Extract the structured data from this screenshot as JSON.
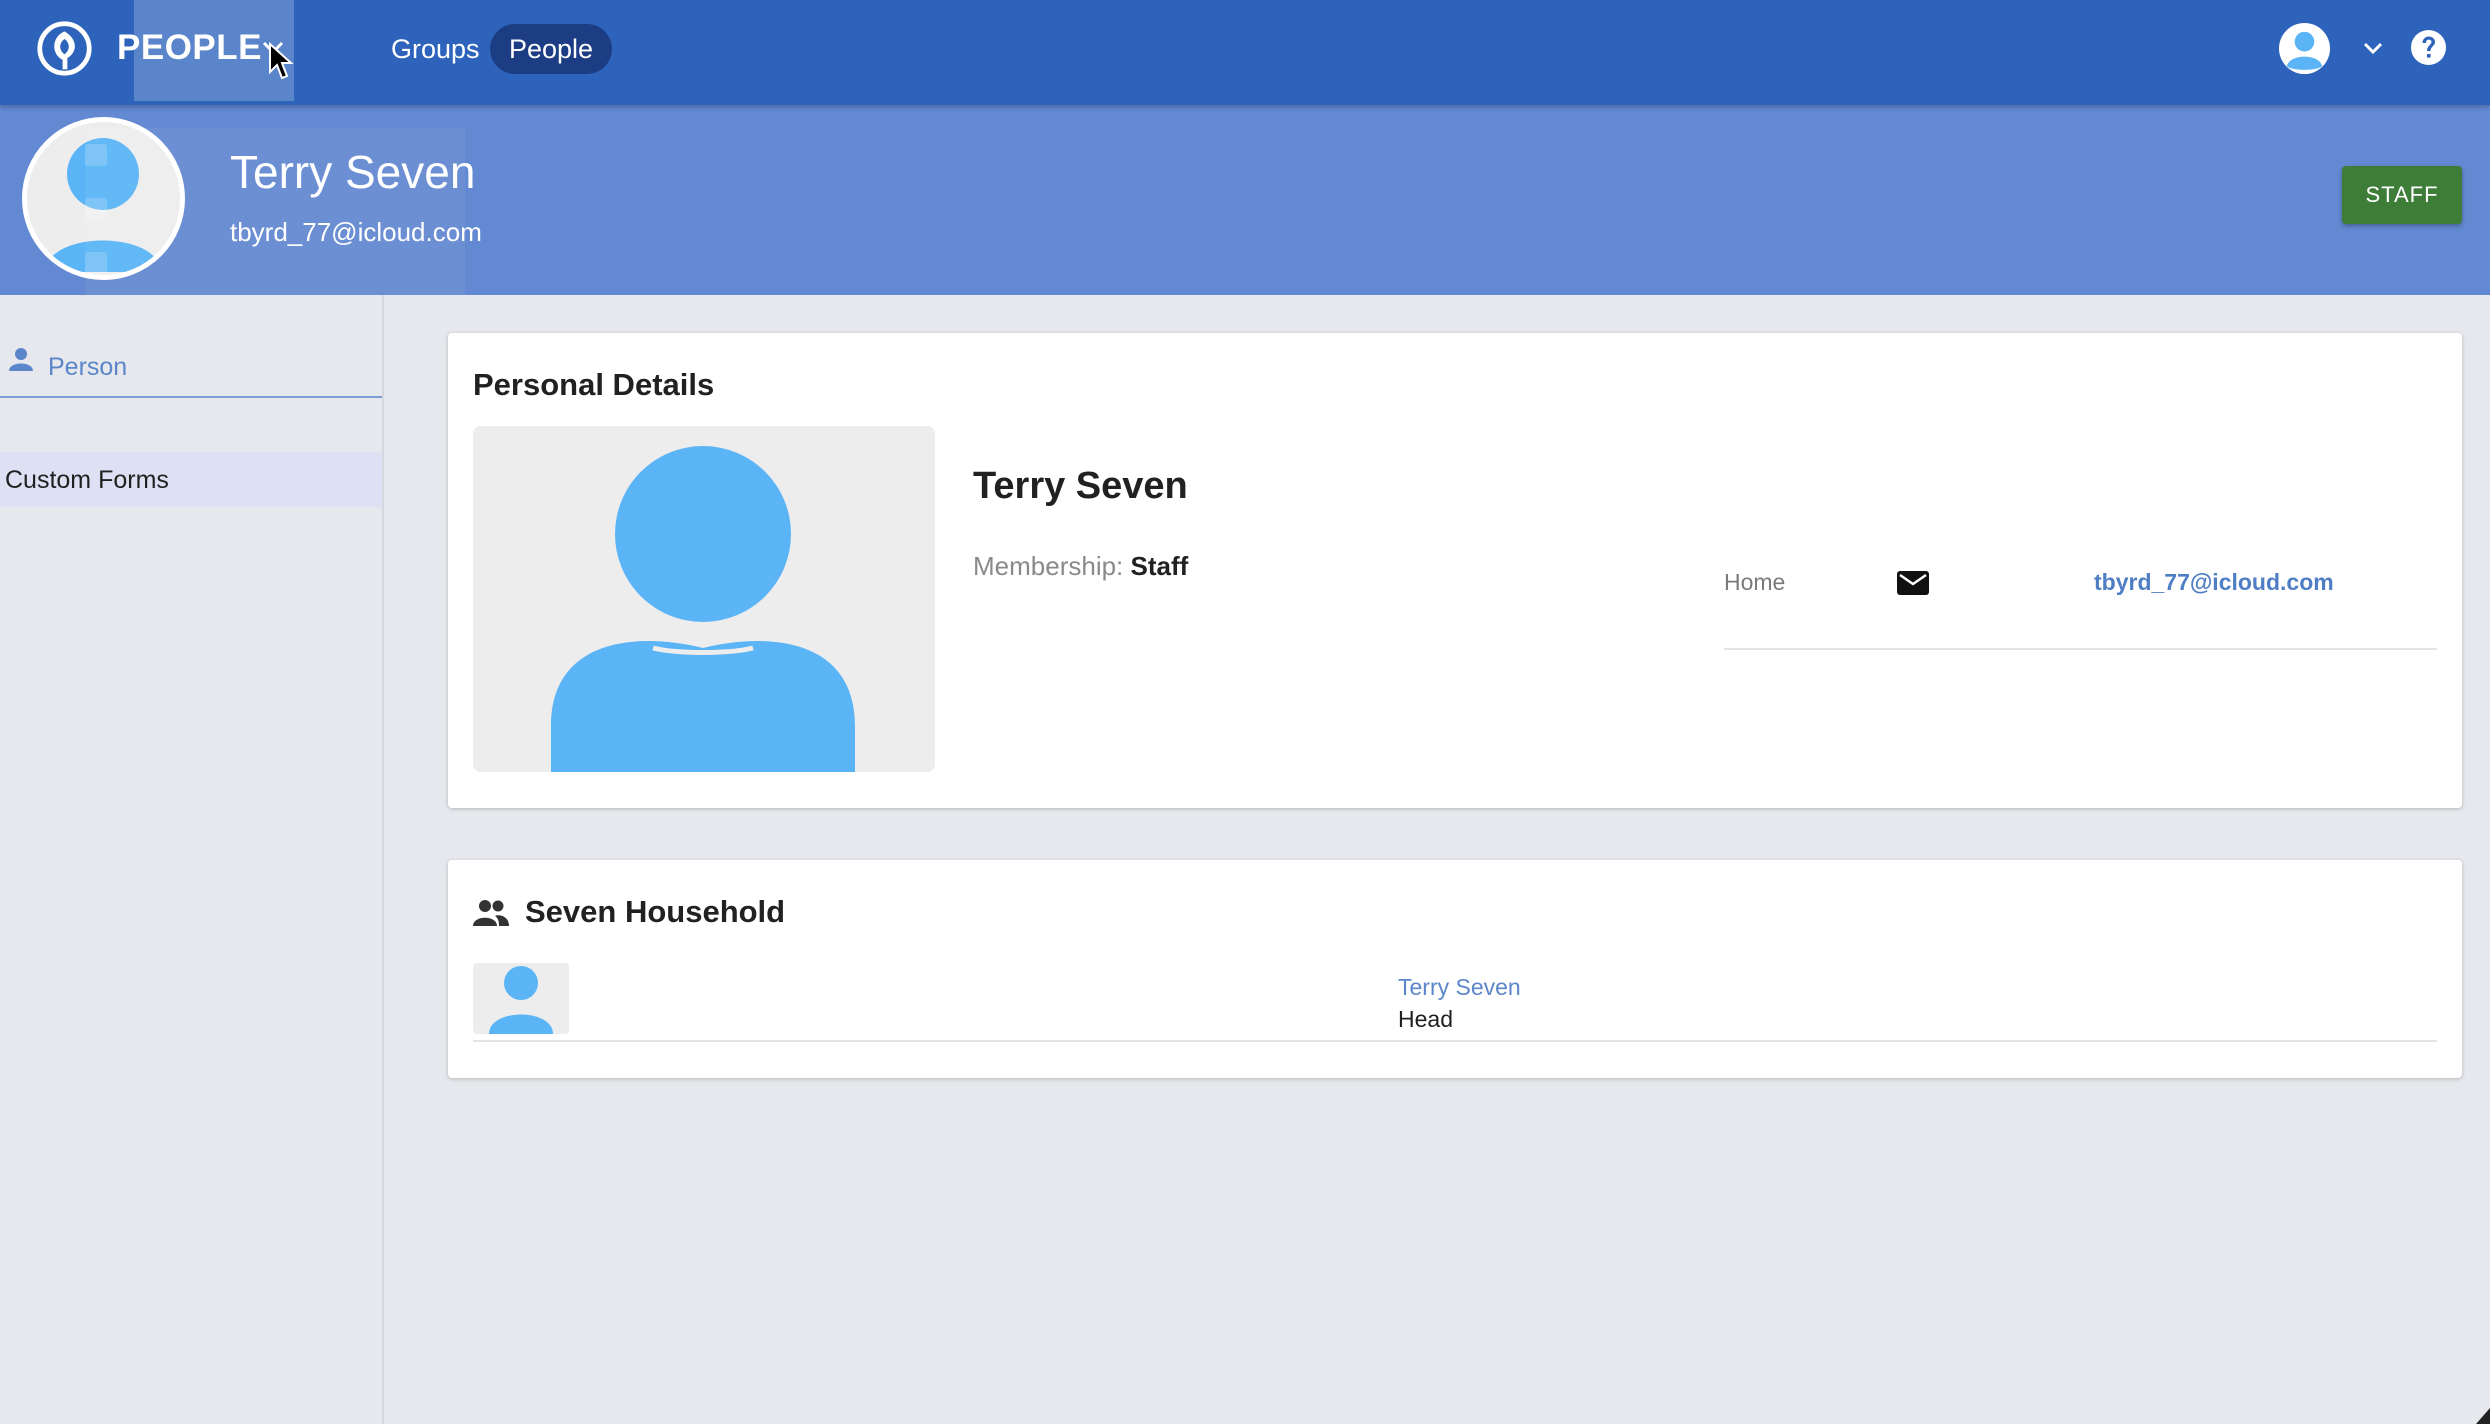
{
  "app": {
    "name": "PEOPLE",
    "brand_color": "#2e63bb",
    "header_color": "#6389d2"
  },
  "nav": {
    "tabs": [
      {
        "label": "Groups",
        "active": false
      },
      {
        "label": "People",
        "active": true
      }
    ]
  },
  "icons": {
    "logo": "church-logo-icon",
    "app_menu": "chevron-down-icon",
    "user": "user-avatar-icon",
    "user_menu": "chevron-down-icon",
    "help": "help-circle-icon",
    "person": "person-icon",
    "mail": "mail-icon",
    "household": "group-icon"
  },
  "header": {
    "name": "Terry Seven",
    "email": "tbyrd_77@icloud.com",
    "badge_label": "STAFF",
    "badge_color": "#3d7d38"
  },
  "side_menu": {
    "items": [
      {
        "label": "Person",
        "active": true
      },
      {
        "label": "Custom Forms",
        "active": false
      }
    ]
  },
  "personal_details": {
    "title": "Personal Details",
    "name": "Terry Seven",
    "membership_label": "Membership:",
    "membership_value": "Staff",
    "contacts": [
      {
        "type": "Home",
        "icon": "mail-icon",
        "value": "tbyrd_77@icloud.com"
      }
    ]
  },
  "household": {
    "title": "Seven Household",
    "members": [
      {
        "name": "Terry Seven",
        "role": "Head"
      }
    ]
  }
}
